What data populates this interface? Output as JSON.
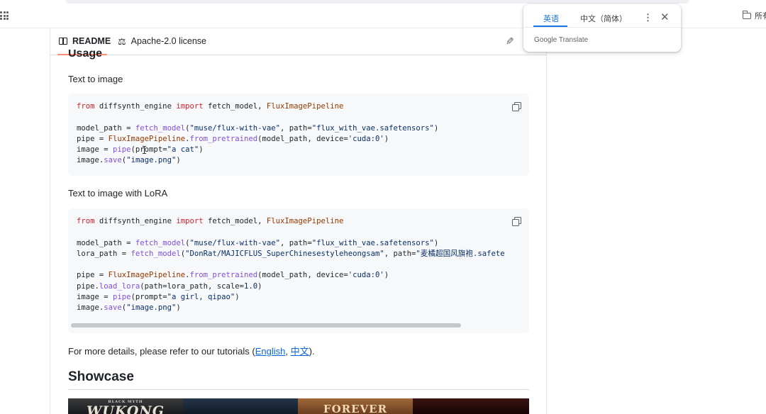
{
  "browser": {
    "bookmarks_label": "所有"
  },
  "readme_header": {
    "readme_tab": "README",
    "license_tab": "Apache-2.0 license"
  },
  "usage": {
    "heading": "Usage",
    "text_to_image": "Text to image",
    "code1": [
      "from diffsynth_engine import fetch_model, FluxImagePipeline",
      "",
      "model_path = fetch_model(\"muse/flux-with-vae\", path=\"flux_with_vae.safetensors\")",
      "pipe = FluxImagePipeline.from_pretrained(model_path, device='cuda:0')",
      "image = pipe(prompt=\"a cat\")",
      "image.save(\"image.png\")"
    ],
    "text_to_image_lora": "Text to image with LoRA",
    "code2": [
      "from diffsynth_engine import fetch_model, FluxImagePipeline",
      "",
      "model_path = fetch_model(\"muse/flux-with-vae\", path=\"flux_with_vae.safetensors\")",
      "lora_path = fetch_model(\"DonRat/MAJICFLUS_SuperChinesestyleheongsam\", path=\"麦橘超国风旗袍.safete",
      "",
      "pipe = FluxImagePipeline.from_pretrained(model_path, device='cuda:0')",
      "pipe.load_lora(path=lora_path, scale=1.0)",
      "image = pipe(prompt=\"a girl, qipao\")",
      "image.save(\"image.png\")"
    ],
    "details_prefix": "For more details, please refer to our tutorials (",
    "link_english": "English",
    "separator": ", ",
    "link_chinese": "中文",
    "details_suffix": ")."
  },
  "showcase": {
    "heading": "Showcase",
    "images": [
      {
        "label_small": "BLACK MYTH",
        "label_big": "WUKONG"
      },
      {
        "label_small": "",
        "label_big": ""
      },
      {
        "label_small": "",
        "label_big": "FOREVER YOUNG"
      },
      {
        "label_small": "",
        "label_big": ""
      }
    ]
  },
  "translate_popup": {
    "tab_active": "英语",
    "tab_second": "中文（简体）",
    "brand": "Google Translate",
    "more_icon": "⋮",
    "close_icon": "✕"
  },
  "colors": {
    "keyword": "#cf222e",
    "function": "#8250df",
    "class": "#953800",
    "string": "#0a3069",
    "link": "#0969da",
    "accent_tab": "#fd8c73",
    "translate_blue": "#1a73e8"
  }
}
